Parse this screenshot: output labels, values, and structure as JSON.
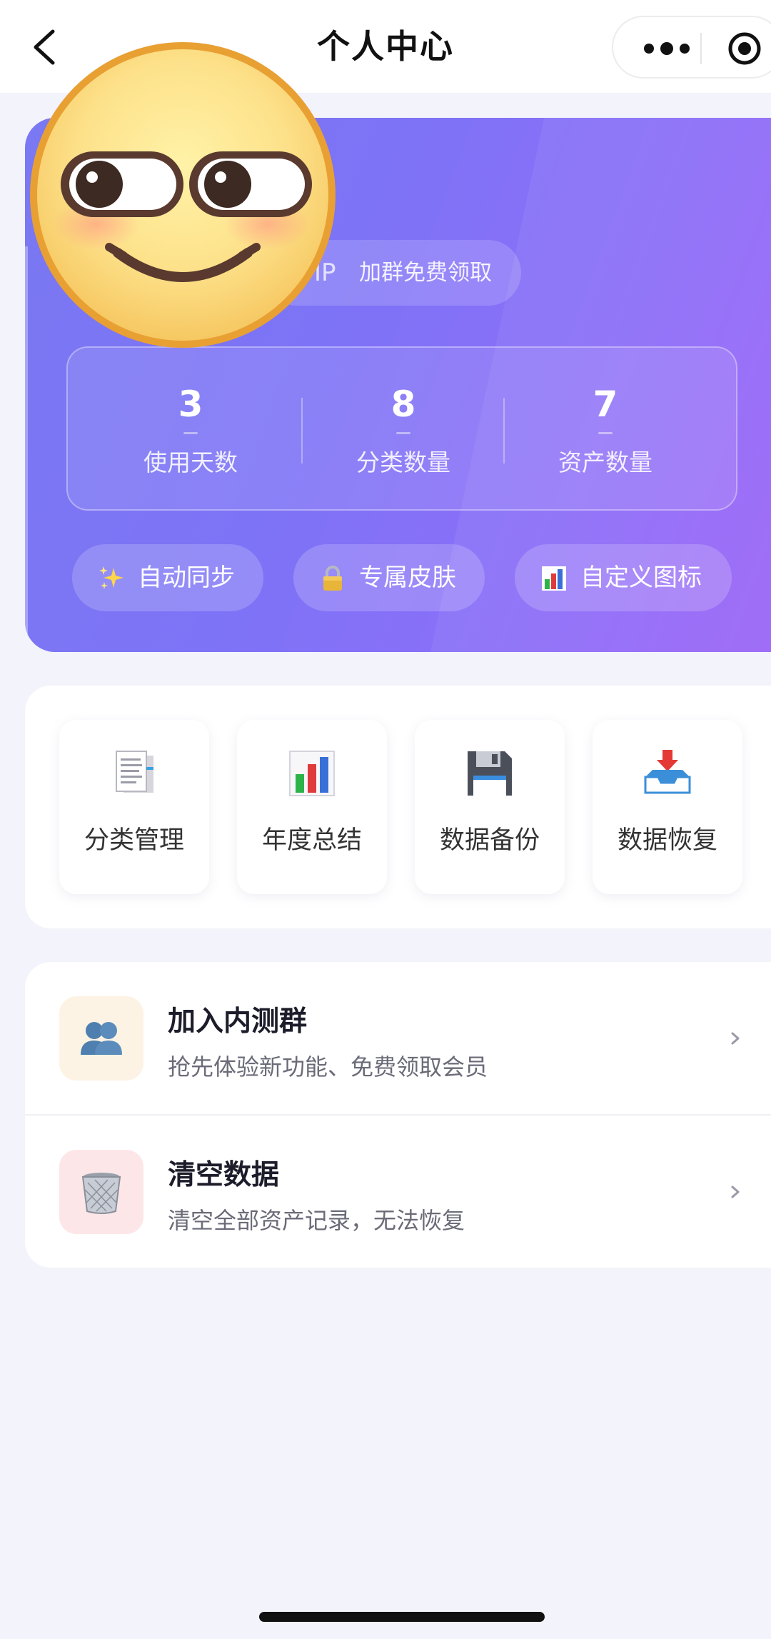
{
  "navbar": {
    "title": "个人中心"
  },
  "profile": {
    "vip_tag": "IP",
    "vip_text": "加群免费领取",
    "stats": [
      {
        "value": "3",
        "label": "使用天数"
      },
      {
        "value": "8",
        "label": "分类数量"
      },
      {
        "value": "7",
        "label": "资产数量"
      }
    ],
    "features": [
      {
        "label": "自动同步",
        "icon": "sparkles-icon"
      },
      {
        "label": "专属皮肤",
        "icon": "lock-icon"
      },
      {
        "label": "自定义图标",
        "icon": "bar-chart-icon"
      }
    ]
  },
  "quick_actions": [
    {
      "label": "分类管理",
      "icon": "documents-icon"
    },
    {
      "label": "年度总结",
      "icon": "bar-chart-icon"
    },
    {
      "label": "数据备份",
      "icon": "floppy-disk-icon"
    },
    {
      "label": "数据恢复",
      "icon": "inbox-tray-icon"
    }
  ],
  "list": [
    {
      "title": "加入内测群",
      "subtitle": "抢先体验新功能、免费领取会员",
      "icon": "people-icon",
      "icon_bg": "#fdf3e4"
    },
    {
      "title": "清空数据",
      "subtitle": "清空全部资产记录，无法恢复",
      "icon": "wastebasket-icon",
      "icon_bg": "#fde6e8"
    }
  ],
  "colors": {
    "hero_gradient_start": "#7a78f2",
    "hero_gradient_end": "#9a64f7",
    "page_background": "#f3f3fb"
  }
}
